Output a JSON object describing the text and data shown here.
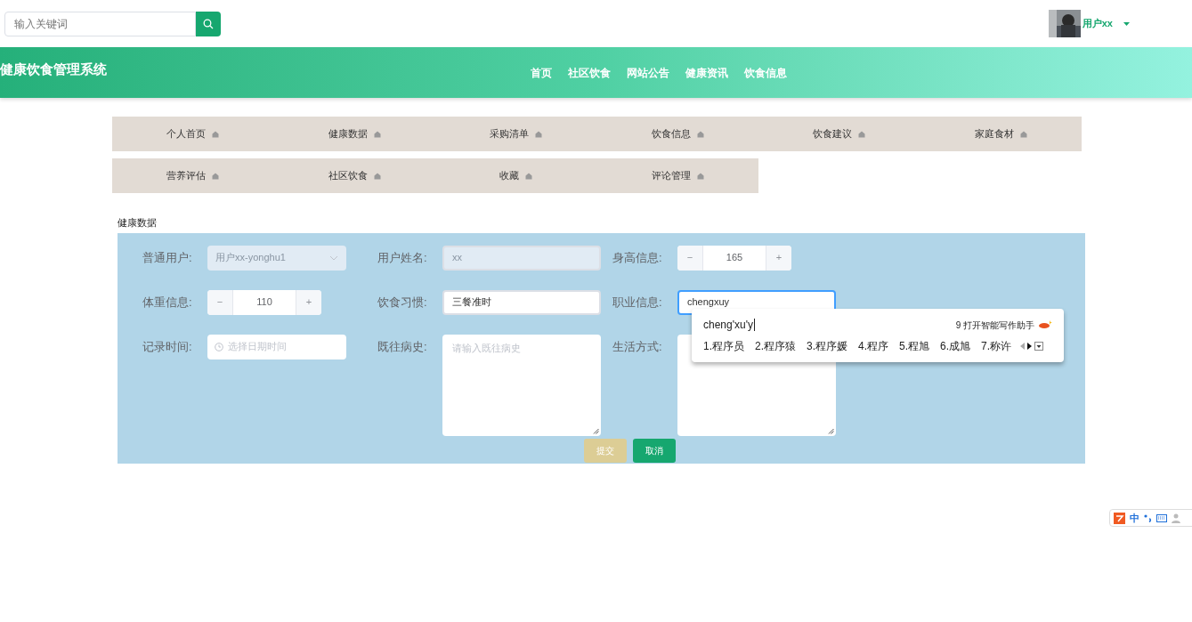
{
  "search": {
    "placeholder": "输入关键词"
  },
  "user": {
    "name": "用户xx"
  },
  "header": {
    "title": "健康饮食管理系统",
    "nav": [
      "首页",
      "社区饮食",
      "网站公告",
      "健康资讯",
      "饮食信息"
    ]
  },
  "menu": {
    "items": [
      {
        "label": "个人首页"
      },
      {
        "label": "健康数据"
      },
      {
        "label": "采购清单"
      },
      {
        "label": "饮食信息"
      },
      {
        "label": "饮食建议"
      },
      {
        "label": "家庭食材"
      },
      {
        "label": "营养评估"
      },
      {
        "label": "社区饮食"
      },
      {
        "label": "收藏"
      },
      {
        "label": "评论管理"
      }
    ]
  },
  "section_title": "健康数据",
  "form": {
    "fields": [
      {
        "kind": "select",
        "label": "普通用户:",
        "value": "用户xx-yonghu1",
        "disabled": true
      },
      {
        "kind": "text",
        "label": "用户姓名:",
        "value": "xx",
        "disabled": true,
        "focused": false
      },
      {
        "kind": "number",
        "label": "身高信息:",
        "value": "165",
        "minus": "−",
        "plus": "+"
      },
      {
        "kind": "number",
        "label": "体重信息:",
        "value": "110",
        "minus": "−",
        "plus": "+"
      },
      {
        "kind": "text",
        "label": "饮食习惯:",
        "value": "三餐准时",
        "disabled": false,
        "focused": false
      },
      {
        "kind": "text",
        "label": "职业信息:",
        "value": "chengxuy",
        "disabled": false,
        "focused": true
      },
      {
        "kind": "date",
        "label": "记录时间:",
        "placeholder": "选择日期时间"
      },
      {
        "kind": "textarea",
        "label": "既往病史:",
        "placeholder": "请输入既往病史"
      },
      {
        "kind": "textarea",
        "label": "生活方式:"
      }
    ],
    "buttons": [
      {
        "label": "提交",
        "kind": "submit"
      },
      {
        "label": "取消",
        "kind": "cancel"
      }
    ]
  },
  "ime": {
    "composition": "cheng'xu'y",
    "hint": "9 打开智能写作助手",
    "candidates": [
      "1.程序员",
      "2.程序猿",
      "3.程序媛",
      "4.程序",
      "5.程旭",
      "6.成旭",
      "7.称许"
    ]
  },
  "ime_toolbar": {
    "mode": "中"
  }
}
